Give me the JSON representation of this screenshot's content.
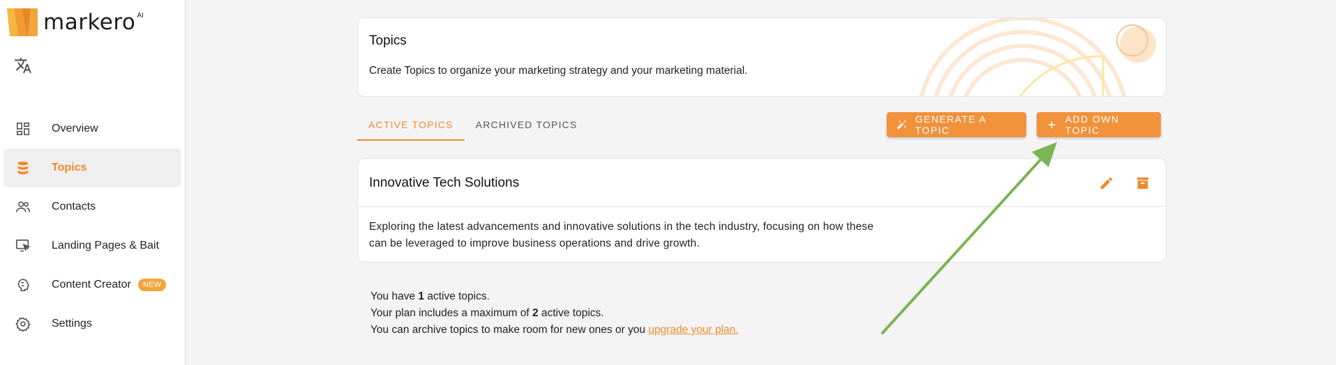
{
  "app": {
    "name": "markero",
    "ai_suffix": "AI",
    "accent_color": "#ef8b2c"
  },
  "sidebar": {
    "translate_icon": "translate-icon",
    "items": [
      {
        "label": "Overview",
        "icon": "dashboard-icon"
      },
      {
        "label": "Topics",
        "icon": "database-icon",
        "active": true
      },
      {
        "label": "Contacts",
        "icon": "people-icon"
      },
      {
        "label": "Landing Pages & Bait",
        "icon": "screen-pointer-icon"
      },
      {
        "label": "Content Creator",
        "icon": "brain-icon",
        "badge": "NEW"
      },
      {
        "label": "Settings",
        "icon": "gear-icon"
      }
    ]
  },
  "header": {
    "title": "Topics",
    "description": "Create Topics to organize your marketing strategy and your marketing material."
  },
  "tabs": [
    {
      "label": "ACTIVE TOPICS",
      "active": true
    },
    {
      "label": "ARCHIVED TOPICS"
    }
  ],
  "actions": {
    "generate_label": "GENERATE A TOPIC",
    "add_label": "ADD OWN TOPIC"
  },
  "topic": {
    "title": "Innovative Tech Solutions",
    "description_line1": "Exploring the latest advancements and innovative solutions in the tech industry, focusing on how these",
    "description_line2": "can be leveraged to improve business operations and drive growth."
  },
  "info": {
    "line1_pre": "You have ",
    "active_count": "1",
    "line1_post": " active topics.",
    "line2_pre": "Your plan includes a maximum of ",
    "max_count": "2",
    "line2_post": " active topics.",
    "line3_pre": "You can archive topics to make room for new ones or you ",
    "upgrade_link": "upgrade your plan."
  }
}
